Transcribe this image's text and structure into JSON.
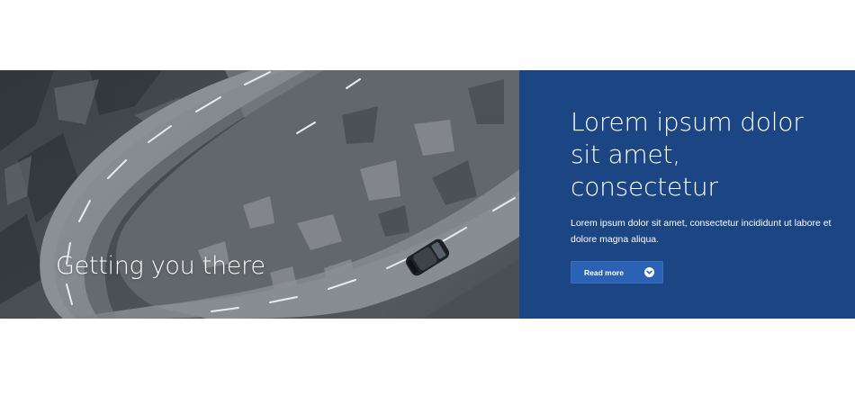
{
  "hero": {
    "caption": "Getting you there",
    "image_subject": "car driving on winding mountain road"
  },
  "panel": {
    "heading": "Lorem ipsum dolor sit amet, consectetur",
    "body": "Lorem ipsum dolor sit amet, consectetur incididunt ut labore et dolore magna aliqua.",
    "button_label": "Read more",
    "button_icon": "chevron-down-icon"
  },
  "colors": {
    "panel_background": "#1b4583",
    "button_background": "#2c62b3",
    "text": "#ffffff"
  }
}
